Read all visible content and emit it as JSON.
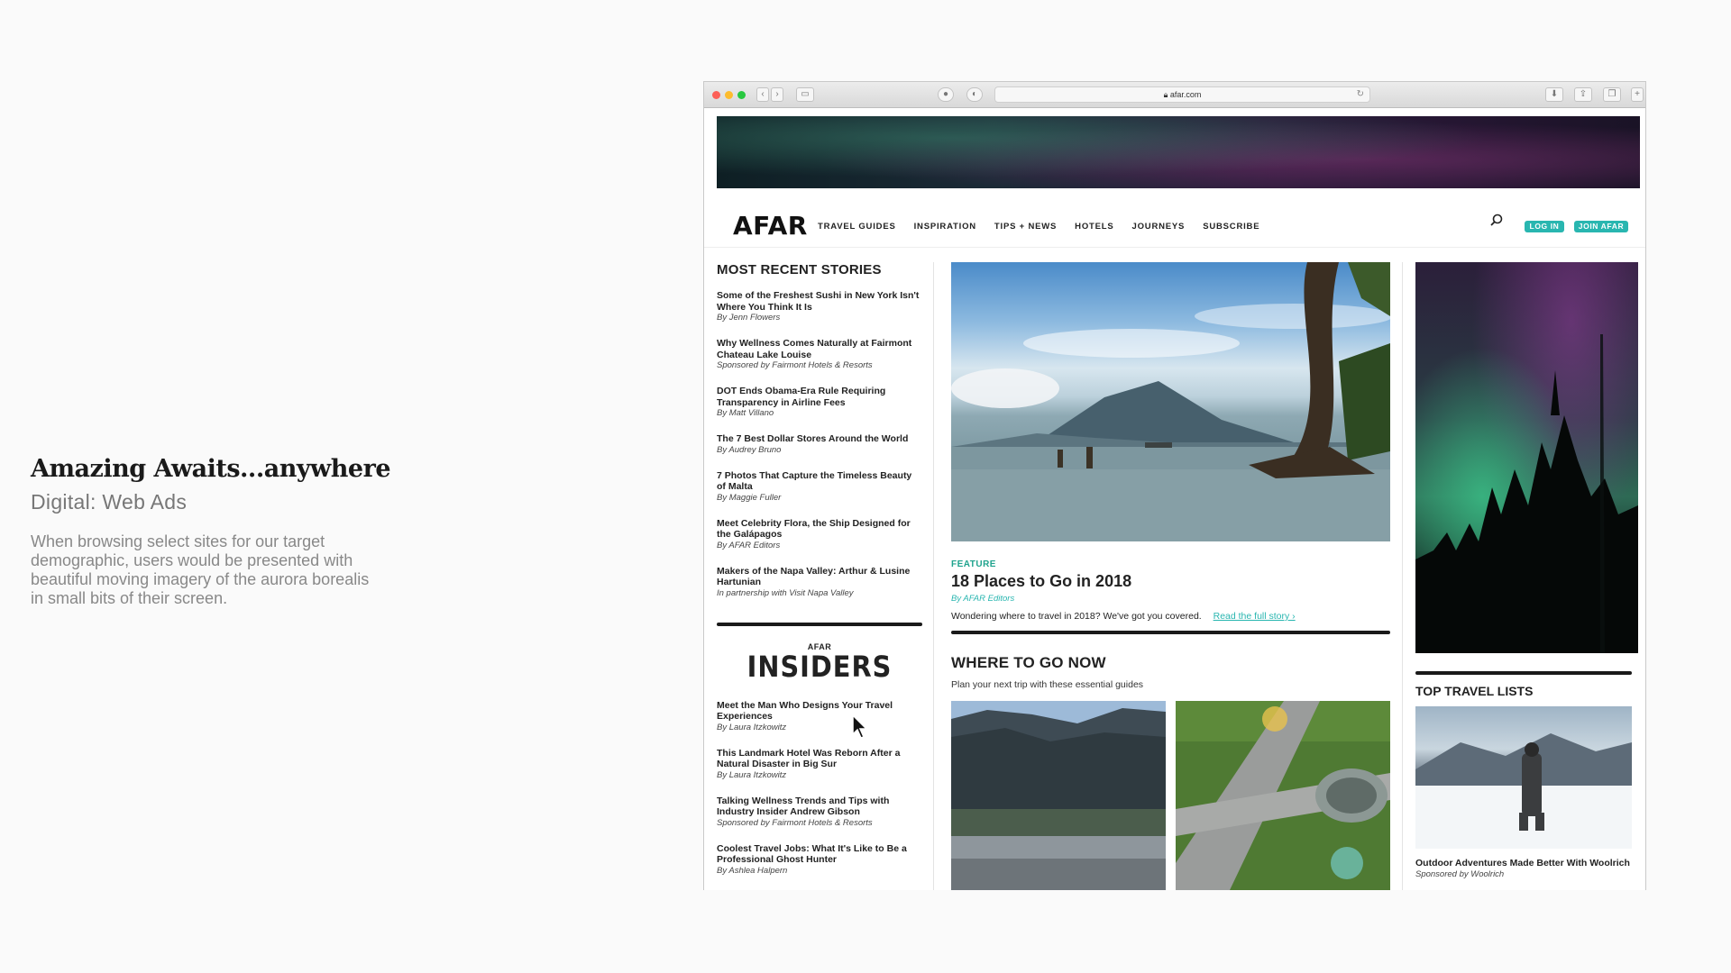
{
  "presentation": {
    "title": "Amazing Awaits...anywhere",
    "subtitle": "Digital: Web Ads",
    "description": "When browsing select sites for our target demographic, users would be presented with beautiful moving imagery of the aurora borealis in small bits of their screen."
  },
  "browser": {
    "url": "afar.com",
    "icons": [
      "back-icon",
      "forward-icon",
      "sidebar-icon",
      "shield-icon",
      "info-icon",
      "reload-icon",
      "download-icon",
      "share-icon",
      "tabs-icon",
      "new-tab-icon"
    ]
  },
  "site": {
    "logo": "AFAR",
    "nav": [
      "TRAVEL GUIDES",
      "INSPIRATION",
      "TIPS + NEWS",
      "HOTELS",
      "JOURNEYS",
      "SUBSCRIBE"
    ],
    "login": "LOG IN",
    "join": "JOIN AFAR",
    "accent": "#29b6b0"
  },
  "recent": {
    "heading": "MOST RECENT STORIES",
    "items": [
      {
        "title": "Some of the Freshest Sushi in New York Isn't Where You Think It Is",
        "byline": "By Jenn Flowers"
      },
      {
        "title": "Why Wellness Comes Naturally at Fairmont Chateau Lake Louise",
        "byline": "Sponsored by Fairmont Hotels & Resorts"
      },
      {
        "title": "DOT Ends Obama-Era Rule Requiring Transparency in Airline Fees",
        "byline": "By Matt Villano"
      },
      {
        "title": "The 7 Best Dollar Stores Around the World",
        "byline": "By Audrey Bruno"
      },
      {
        "title": "7 Photos That Capture the Timeless Beauty of Malta",
        "byline": "By Maggie Fuller"
      },
      {
        "title": "Meet Celebrity Flora, the Ship Designed for the Galápagos",
        "byline": "By AFAR Editors"
      },
      {
        "title": "Makers of the Napa Valley: Arthur & Lusine Hartunian",
        "byline": "In partnership with Visit Napa Valley"
      }
    ]
  },
  "insiders": {
    "small": "AFAR",
    "big": "INSIDERS",
    "items": [
      {
        "title": "Meet the Man Who Designs Your Travel Experiences",
        "byline": "By Laura Itzkowitz"
      },
      {
        "title": "This Landmark Hotel Was Reborn After a Natural Disaster in Big Sur",
        "byline": "By Laura Itzkowitz"
      },
      {
        "title": "Talking Wellness Trends and Tips with Industry Insider Andrew Gibson",
        "byline": "Sponsored by Fairmont Hotels & Resorts"
      },
      {
        "title": "Coolest Travel Jobs: What It's Like to Be a Professional Ghost Hunter",
        "byline": "By Ashlea Halpern"
      }
    ]
  },
  "feature": {
    "kicker": "FEATURE",
    "title": "18 Places to Go in 2018",
    "byline": "By AFAR Editors",
    "desc": "Wondering where to travel in 2018? We've got you covered.",
    "link": "Read the full story ›"
  },
  "where": {
    "heading": "WHERE TO GO NOW",
    "sub": "Plan your next trip with these essential guides"
  },
  "top": {
    "heading": "TOP TRAVEL LISTS",
    "title": "Outdoor Adventures Made Better With Woolrich",
    "byline": "Sponsored by Woolrich"
  }
}
